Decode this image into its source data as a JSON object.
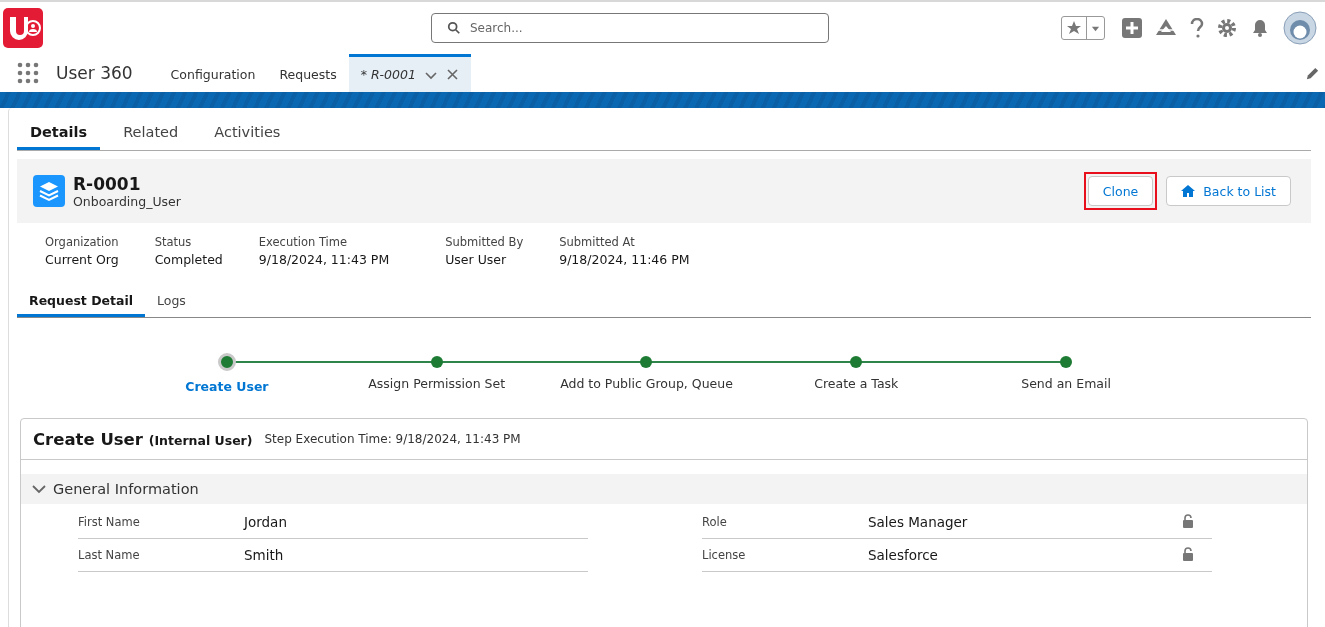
{
  "header": {
    "search": {
      "placeholder": "Search..."
    }
  },
  "nav": {
    "app_name": "User 360",
    "tabs": [
      {
        "label": "Configuration",
        "selected": false,
        "kind": "plain"
      },
      {
        "label": "Requests",
        "selected": false,
        "kind": "plain"
      },
      {
        "label": "* R-0001",
        "selected": true,
        "kind": "record"
      }
    ]
  },
  "record_tabs": [
    {
      "label": "Details",
      "selected": true
    },
    {
      "label": "Related",
      "selected": false
    },
    {
      "label": "Activities",
      "selected": false
    }
  ],
  "record": {
    "title": "R-0001",
    "subtitle": "Onboarding_User",
    "buttons": [
      {
        "label": "Clone",
        "kind": "plain",
        "highlighted": true
      },
      {
        "label": "Back to List",
        "kind": "home",
        "highlighted": false
      }
    ],
    "fields": [
      {
        "label": "Organization",
        "value": "Current Org"
      },
      {
        "label": "Status",
        "value": "Completed"
      },
      {
        "label": "Execution Time",
        "value": "9/18/2024, 11:43 PM"
      },
      {
        "label": "Submitted By",
        "value": "User User"
      },
      {
        "label": "Submitted At",
        "value": "9/18/2024, 11:46 PM"
      }
    ]
  },
  "sub_tabs": [
    {
      "label": "Request Detail",
      "selected": true
    },
    {
      "label": "Logs",
      "selected": false
    }
  ],
  "path": [
    {
      "label": "Create User",
      "selected": true
    },
    {
      "label": "Assign Permission Set",
      "selected": false
    },
    {
      "label": "Add to Public Group, Queue",
      "selected": false
    },
    {
      "label": "Create a Task",
      "selected": false
    },
    {
      "label": "Send an Email",
      "selected": false
    }
  ],
  "step": {
    "title": "Create User",
    "qualifier": "(Internal User)",
    "execution": "Step Execution Time: 9/18/2024, 11:43 PM",
    "section": {
      "title": "General Information",
      "expanded": true,
      "rows": [
        [
          {
            "label": "First Name",
            "value": "Jordan",
            "locked": false
          },
          {
            "label": "Role",
            "value": "Sales Manager",
            "locked": true
          }
        ],
        [
          {
            "label": "Last Name",
            "value": "Smith",
            "locked": false
          },
          {
            "label": "License",
            "value": "Salesforce",
            "locked": true
          }
        ]
      ]
    }
  }
}
